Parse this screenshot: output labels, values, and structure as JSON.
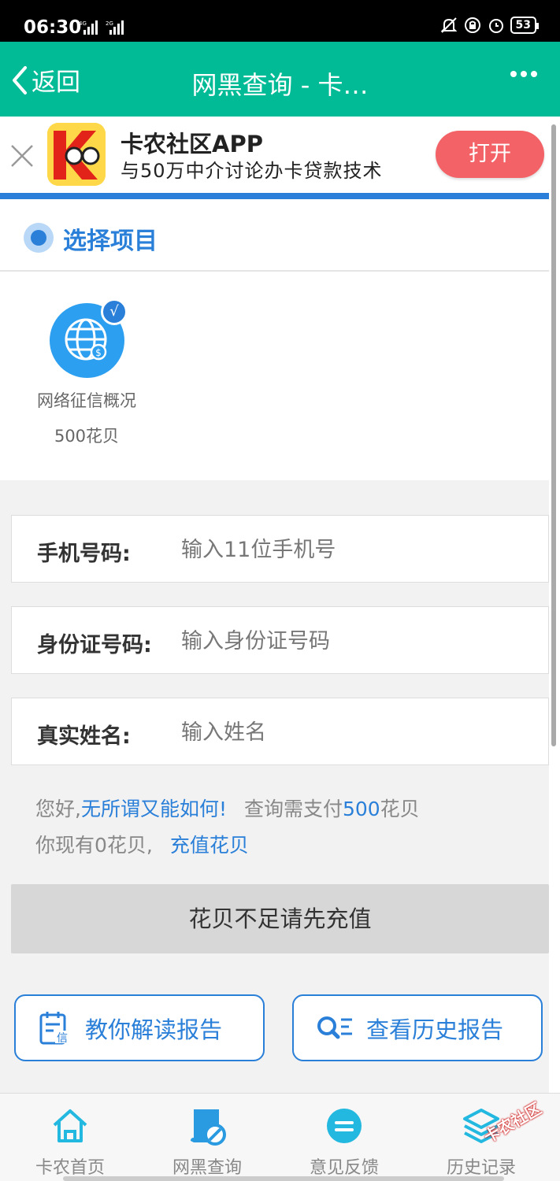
{
  "status_bar": {
    "time": "06:30",
    "battery": "53",
    "net1": "4G",
    "net2": "2G"
  },
  "nav": {
    "back_label": "返回",
    "title": "网黑查询 - 卡…"
  },
  "app_banner": {
    "title": "卡农社区APP",
    "subtitle": "与50万中介讨论办卡贷款技术",
    "open_label": "打开"
  },
  "section": {
    "title": "选择项目"
  },
  "items": [
    {
      "name": "网络征信概况",
      "price": "500花贝",
      "selected": true
    }
  ],
  "form": {
    "phone": {
      "label": "手机号码:",
      "placeholder": "输入11位手机号"
    },
    "id_card": {
      "label": "身份证号码:",
      "placeholder": "输入身份证号码"
    },
    "name": {
      "label": "真实姓名:",
      "placeholder": "输入姓名"
    }
  },
  "info": {
    "greeting_prefix": "您好,",
    "username": "无所谓又能如何!",
    "pay_prefix": "查询需支付",
    "pay_amount": "500",
    "pay_unit": "花贝",
    "balance_text": "你现有0花贝,",
    "recharge_label": "充值花贝"
  },
  "submit_label": "花贝不足请先充值",
  "actions": {
    "guide_label": "教你解读报告",
    "history_label": "查看历史报告"
  },
  "tabs": [
    {
      "label": "卡农首页",
      "icon": "home-icon"
    },
    {
      "label": "网黑查询",
      "icon": "blacklist-query-icon"
    },
    {
      "label": "意见反馈",
      "icon": "feedback-icon"
    },
    {
      "label": "历史记录",
      "icon": "layers-icon"
    }
  ],
  "watermark": "卡农社区",
  "colors": {
    "primary_green": "#00bb96",
    "accent_blue": "#2a7fd8",
    "open_red": "#f36266"
  }
}
